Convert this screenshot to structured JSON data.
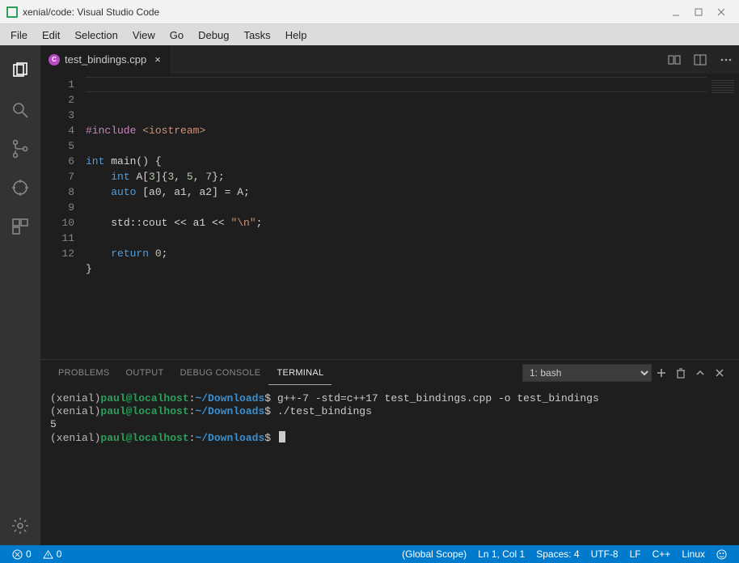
{
  "window": {
    "title": "xenial/code: Visual Studio Code"
  },
  "menubar": [
    "File",
    "Edit",
    "Selection",
    "View",
    "Go",
    "Debug",
    "Tasks",
    "Help"
  ],
  "tab": {
    "filename": "test_bindings.cpp"
  },
  "code": {
    "lines": [
      {
        "n": "1",
        "html": "<span class='tok-include'>#include</span> <span class='tok-string'>&lt;iostream&gt;</span>"
      },
      {
        "n": "2",
        "html": ""
      },
      {
        "n": "3",
        "html": "<span class='tok-keyword'>int</span> <span class='tok-text'>main() {</span>"
      },
      {
        "n": "4",
        "html": "    <span class='tok-keyword'>int</span> <span class='tok-text'>A[</span><span class='tok-number'>3</span><span class='tok-text'>]{</span><span class='tok-number'>3</span><span class='tok-text'>, </span><span class='tok-number'>5</span><span class='tok-text'>, </span><span class='tok-number'>7</span><span class='tok-text'>};</span>"
      },
      {
        "n": "5",
        "html": "    <span class='tok-keyword'>auto</span> <span class='tok-text'>[a0, a1, a2] = A;</span>"
      },
      {
        "n": "6",
        "html": ""
      },
      {
        "n": "7",
        "html": "    <span class='tok-text'>std::cout &lt;&lt; a1 &lt;&lt; </span><span class='tok-string'>\"\\n\"</span><span class='tok-text'>;</span>"
      },
      {
        "n": "8",
        "html": ""
      },
      {
        "n": "9",
        "html": "    <span class='tok-keyword'>return</span> <span class='tok-number'>0</span><span class='tok-text'>;</span>"
      },
      {
        "n": "10",
        "html": "<span class='tok-text'>}</span>"
      },
      {
        "n": "11",
        "html": ""
      },
      {
        "n": "12",
        "html": ""
      }
    ]
  },
  "panel": {
    "tabs": {
      "problems": "PROBLEMS",
      "output": "OUTPUT",
      "debug": "DEBUG CONSOLE",
      "terminal": "TERMINAL"
    },
    "shell_selected": "1: bash",
    "lines": [
      {
        "env": "(xenial)",
        "user": "paul@localhost",
        "sep": ":",
        "path": "~/Downloads",
        "prompt": "$",
        "cmd": " g++-7 -std=c++17 test_bindings.cpp -o test_bindings"
      },
      {
        "env": "(xenial)",
        "user": "paul@localhost",
        "sep": ":",
        "path": "~/Downloads",
        "prompt": "$",
        "cmd": " ./test_bindings"
      },
      {
        "raw": "5"
      },
      {
        "env": "(xenial)",
        "user": "paul@localhost",
        "sep": ":",
        "path": "~/Downloads",
        "prompt": "$",
        "cmd": " ",
        "cursor": true
      }
    ]
  },
  "status": {
    "errors": "0",
    "warnings": "0",
    "scope": "(Global Scope)",
    "lncol": "Ln 1, Col 1",
    "spaces": "Spaces: 4",
    "encoding": "UTF-8",
    "eol": "LF",
    "lang": "C++",
    "os": "Linux"
  }
}
